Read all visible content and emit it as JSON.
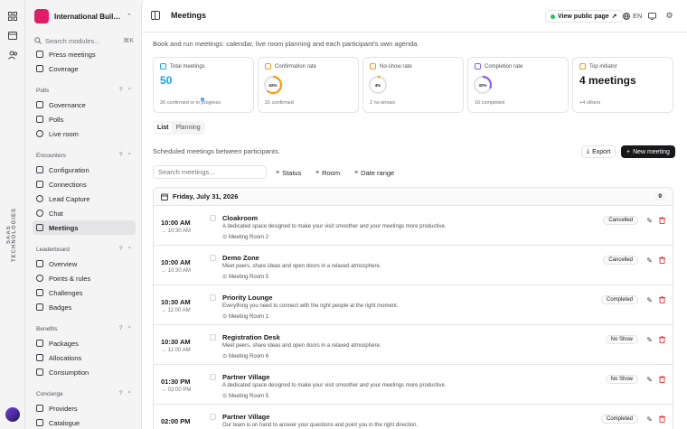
{
  "rail": {
    "brand": "SAAS TECHNOLOGIES"
  },
  "org": {
    "name": "International Buildi..."
  },
  "sidebar_search": {
    "placeholder": "Search modules...",
    "shortcut": "⌘K"
  },
  "sidebar": {
    "top_items": [
      {
        "label": "Press meetings",
        "icon": "newspaper-icon"
      },
      {
        "label": "Coverage",
        "icon": "chart-icon"
      }
    ],
    "groups": [
      {
        "title": "Polls",
        "items": [
          {
            "label": "Governance",
            "icon": "gear-icon"
          },
          {
            "label": "Polls",
            "icon": "list-icon"
          },
          {
            "label": "Live room",
            "icon": "live-icon"
          }
        ]
      },
      {
        "title": "Encounters",
        "items": [
          {
            "label": "Configuration",
            "icon": "gear-icon"
          },
          {
            "label": "Connections",
            "icon": "link-icon"
          },
          {
            "label": "Lead Capture",
            "icon": "target-icon"
          },
          {
            "label": "Chat",
            "icon": "chat-icon"
          },
          {
            "label": "Meetings",
            "icon": "calendar-icon",
            "active": true
          }
        ]
      },
      {
        "title": "Leaderboard",
        "items": [
          {
            "label": "Overview",
            "icon": "grid-icon"
          },
          {
            "label": "Points & rules",
            "icon": "star-icon"
          },
          {
            "label": "Challenges",
            "icon": "flag-icon"
          },
          {
            "label": "Badges",
            "icon": "badge-icon"
          }
        ]
      },
      {
        "title": "Benefits",
        "items": [
          {
            "label": "Packages",
            "icon": "package-icon"
          },
          {
            "label": "Allocations",
            "icon": "allocation-icon"
          },
          {
            "label": "Consumption",
            "icon": "consumption-icon"
          }
        ]
      },
      {
        "title": "Concierge",
        "items": [
          {
            "label": "Providers",
            "icon": "provider-icon"
          },
          {
            "label": "Catalogue",
            "icon": "catalogue-icon"
          }
        ]
      }
    ]
  },
  "topbar": {
    "title": "Meetings",
    "public_page": "View public page",
    "lang": "EN"
  },
  "intro": "Book and run meetings: calendar, live room planning and each participant's own agenda.",
  "stats": [
    {
      "label": "Total meetings",
      "value": "50",
      "sub": "26 confirmed or in progress",
      "icon_color": "#0ea5e9"
    },
    {
      "label": "Confirmation rate",
      "value": "62%",
      "sub": "31 confirmed",
      "icon_color": "#f59e0b",
      "ring_color": "#f59e0b",
      "ring_pct": 62
    },
    {
      "label": "No-show rate",
      "value": "4%",
      "sub": "2 no-shows",
      "icon_color": "#f59e0b",
      "ring_color": "#f59e0b",
      "ring_pct": 4
    },
    {
      "label": "Completion rate",
      "value": "32%",
      "sub": "16 completed",
      "icon_color": "#8b5cf6",
      "ring_color": "#8b5cf6",
      "ring_pct": 32
    },
    {
      "label": "Top initiator",
      "value": "4 meetings",
      "sub": "+4 others",
      "icon_color": "#f59e0b"
    }
  ],
  "tabs": [
    "List",
    "Planning"
  ],
  "caption": "Scheduled meetings between participants.",
  "actions": {
    "export": "Export",
    "new": "New meeting"
  },
  "search": {
    "placeholder": "Search meetings..."
  },
  "filters": [
    "Status",
    "Room",
    "Date range"
  ],
  "day": {
    "label": "Friday, July 31, 2026",
    "count": "9"
  },
  "meetings": [
    {
      "start": "10:00 AM",
      "end": "→ 10:30 AM",
      "title": "Cloakroom",
      "desc": "A dedicated space designed to make your visit smoother and your meetings more productive.",
      "room": "Meeting Room 2",
      "status": "Cancelled"
    },
    {
      "start": "10:00 AM",
      "end": "→ 10:30 AM",
      "title": "Demo Zone",
      "desc": "Meet peers, share ideas and open doors in a relaxed atmosphere.",
      "room": "Meeting Room 5",
      "status": "Cancelled"
    },
    {
      "start": "10:30 AM",
      "end": "→ 11:00 AM",
      "title": "Priority Lounge",
      "desc": "Everything you need to connect with the right people at the right moment.",
      "room": "Meeting Room 1",
      "status": "Completed"
    },
    {
      "start": "10:30 AM",
      "end": "→ 11:00 AM",
      "title": "Registration Desk",
      "desc": "Meet peers, share ideas and open doors in a relaxed atmosphere.",
      "room": "Meeting Room 6",
      "status": "No Show"
    },
    {
      "start": "01:30 PM",
      "end": "→ 02:00 PM",
      "title": "Partner Village",
      "desc": "A dedicated space designed to make your visit smoother and your meetings more productive.",
      "room": "Meeting Room 5",
      "status": "No Show"
    },
    {
      "start": "02:00 PM",
      "end": "",
      "title": "Partner Village",
      "desc": "Our team is on hand to answer your questions and point you in the right direction.",
      "room": "",
      "status": "Completed"
    }
  ]
}
